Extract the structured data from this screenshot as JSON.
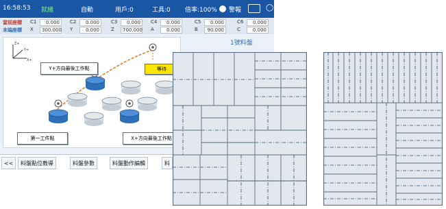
{
  "status": {
    "time": "16:58:53",
    "state": "就緒",
    "mode": "自動",
    "user": "用戶:0",
    "tool": "工具:0",
    "rate": "倍率:100%",
    "alarm": "警報"
  },
  "coords": {
    "row1_label": "當前座標",
    "row2_label": "末端座標",
    "row1": [
      {
        "axis": "C1",
        "value": "0.000"
      },
      {
        "axis": "C2",
        "value": "0.000"
      },
      {
        "axis": "C3",
        "value": "0.000"
      },
      {
        "axis": "C4",
        "value": "0.000"
      },
      {
        "axis": "C5",
        "value": "0.000"
      },
      {
        "axis": "C6",
        "value": "0.000"
      }
    ],
    "row2": [
      {
        "axis": "X",
        "value": "300.000"
      },
      {
        "axis": "Y",
        "value": "0.000"
      },
      {
        "axis": "Z",
        "value": "700.000"
      },
      {
        "axis": "A",
        "value": "0.000"
      },
      {
        "axis": "B",
        "value": "90.000"
      },
      {
        "axis": "C",
        "value": "0.000"
      }
    ]
  },
  "diagram": {
    "axis_z": "Z+",
    "axis_y": "Y+",
    "axis_x": "X+",
    "btn_y_last": "Y+方向最後工作點",
    "btn_yellow": "等待",
    "btn_first": "第一工件點",
    "btn_x_last": "X+方向最後工作點",
    "tray_title": "1號料盤"
  },
  "tabs": [
    {
      "label": "<<"
    },
    {
      "label": "料盤點位教導"
    },
    {
      "label": "料盤參數"
    },
    {
      "label": "料盤動作編輯"
    },
    {
      "label": "料"
    }
  ],
  "colors": {
    "status_bar": "#1b56a4",
    "accent_yellow": "#ffe600",
    "workpiece_blue": "#2d6fb8",
    "workpiece_gray": "#d6dde4",
    "path_orange": "#e07b1a",
    "sheet_fill": "#e3e8ee",
    "sheet_line": "#5b6d80"
  }
}
